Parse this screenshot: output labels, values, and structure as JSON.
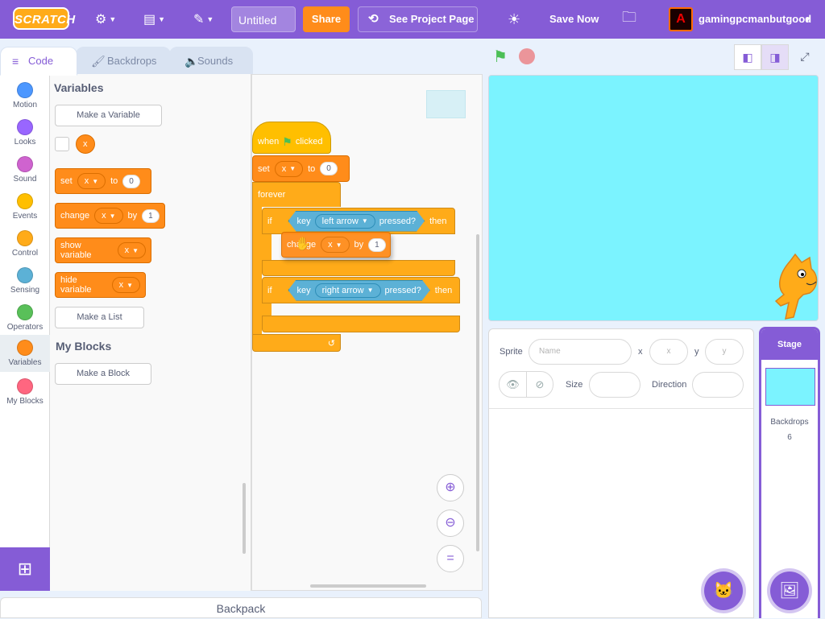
{
  "menu": {
    "logo": "SCRATCH",
    "title_value": "Untitled",
    "share": "Share",
    "see_project": "See Project Page",
    "save_now": "Save Now",
    "username": "gamingpcmanbutgood"
  },
  "tabs": [
    "Code",
    "Backdrops",
    "Sounds"
  ],
  "categories": [
    {
      "label": "Motion",
      "color": "#4c97ff"
    },
    {
      "label": "Looks",
      "color": "#9966ff"
    },
    {
      "label": "Sound",
      "color": "#cf63cf"
    },
    {
      "label": "Events",
      "color": "#ffbf00"
    },
    {
      "label": "Control",
      "color": "#ffab19"
    },
    {
      "label": "Sensing",
      "color": "#5cb1d6"
    },
    {
      "label": "Operators",
      "color": "#59c059"
    },
    {
      "label": "Variables",
      "color": "#ff8c1a"
    },
    {
      "label": "My Blocks",
      "color": "#ff6680"
    }
  ],
  "palette": {
    "variables_heading": "Variables",
    "make_variable": "Make a Variable",
    "var_name": "x",
    "set_block": {
      "verb": "set",
      "var": "x",
      "to": "to",
      "value": "0"
    },
    "change_block": {
      "verb": "change",
      "var": "x",
      "by": "by",
      "value": "1"
    },
    "show_block": {
      "verb": "show variable",
      "var": "x"
    },
    "hide_block": {
      "verb": "hide variable",
      "var": "x"
    },
    "make_list": "Make a List",
    "myblocks_heading": "My Blocks",
    "make_block": "Make a Block"
  },
  "script": {
    "hat": {
      "when": "when",
      "clicked": "clicked"
    },
    "set": {
      "verb": "set",
      "var": "x",
      "to": "to",
      "value": "0"
    },
    "forever": "forever",
    "if1": {
      "if": "if",
      "key": "key",
      "keyname": "left arrow",
      "pressed": "pressed?",
      "then": "then"
    },
    "dragged": {
      "verb": "change",
      "var": "x",
      "by": "by",
      "value": "1"
    },
    "if2": {
      "if": "if",
      "key": "key",
      "keyname": "right arrow",
      "pressed": "pressed?",
      "then": "then"
    }
  },
  "backpack": "Backpack",
  "sprite_info": {
    "sprite_label": "Sprite",
    "name_placeholder": "Name",
    "x_label": "x",
    "x_placeholder": "x",
    "y_label": "y",
    "y_placeholder": "y",
    "size_label": "Size",
    "direction_label": "Direction"
  },
  "stage_pane": {
    "title": "Stage",
    "backdrops_label": "Backdrops",
    "backdrops_count": "6"
  }
}
